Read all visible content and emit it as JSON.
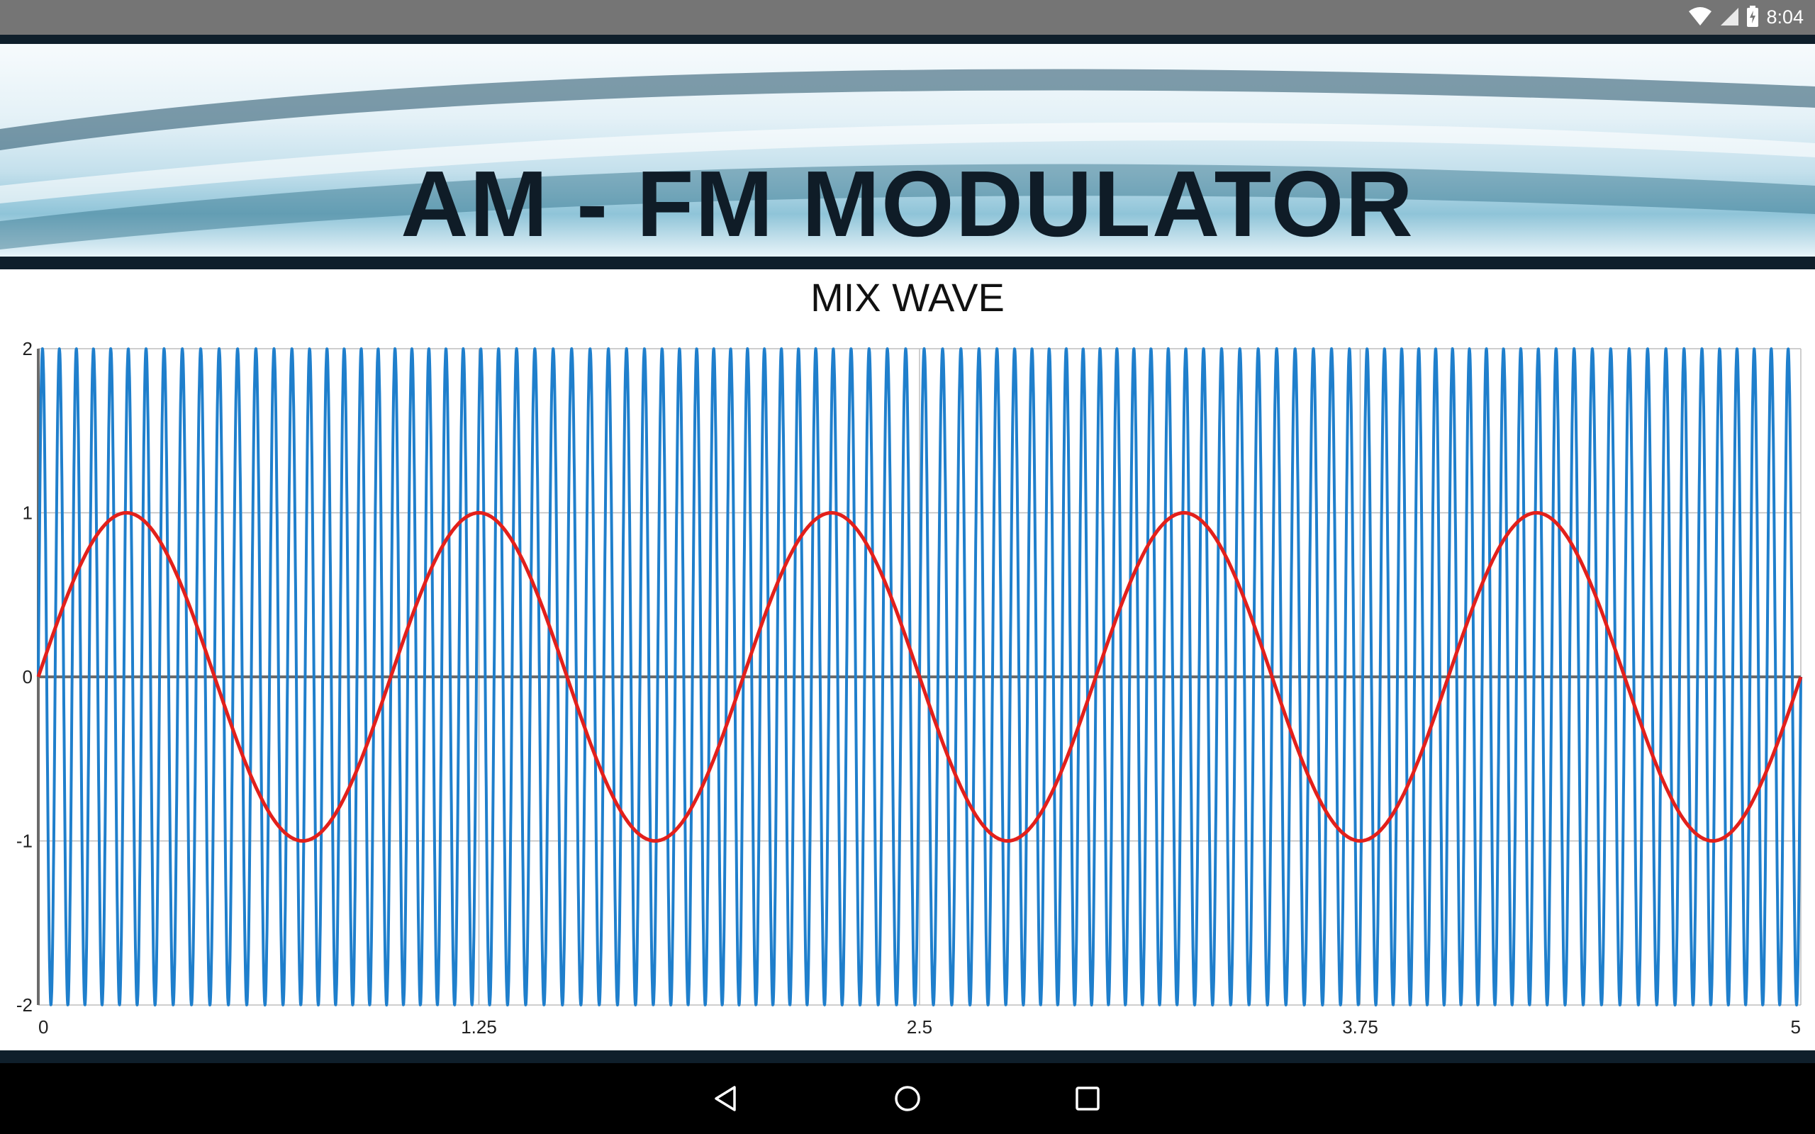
{
  "status_bar": {
    "time": "8:04",
    "icons": [
      "wifi-icon",
      "cellular-signal-icon",
      "battery-charging-icon"
    ]
  },
  "banner": {
    "title": "AM - FM MODULATOR"
  },
  "chart_title": "MIX WAVE",
  "colors": {
    "carrier_series": "#1f7fcc",
    "modulating_series": "#e3201b",
    "grid": "#bdbdbd",
    "axis": "#6b6b6b"
  },
  "chart_data": {
    "type": "line",
    "title": "MIX WAVE",
    "xlabel": "",
    "ylabel": "",
    "xlim": [
      0,
      5
    ],
    "ylim": [
      -2,
      2
    ],
    "x_ticks": [
      "0",
      "1.25",
      "2.5",
      "3.75",
      "5"
    ],
    "y_ticks": [
      "2",
      "1",
      "0",
      "-1",
      "-2"
    ],
    "grid": true,
    "legend": "none",
    "series": [
      {
        "color": "#e3201b",
        "description_values": "sine, amplitude 1, period 1 (5 cycles over x 0 to 5)",
        "amplitude": 1,
        "cycles": 5
      },
      {
        "color": "#1f7fcc",
        "description_values": "frequency-modulated carrier, amplitude 2, about 100 cycles over x 0 to 5",
        "amplitude": 2,
        "cycles": 100
      }
    ]
  },
  "nav_bar": {
    "buttons": [
      "back-icon",
      "home-icon",
      "recents-icon"
    ]
  }
}
